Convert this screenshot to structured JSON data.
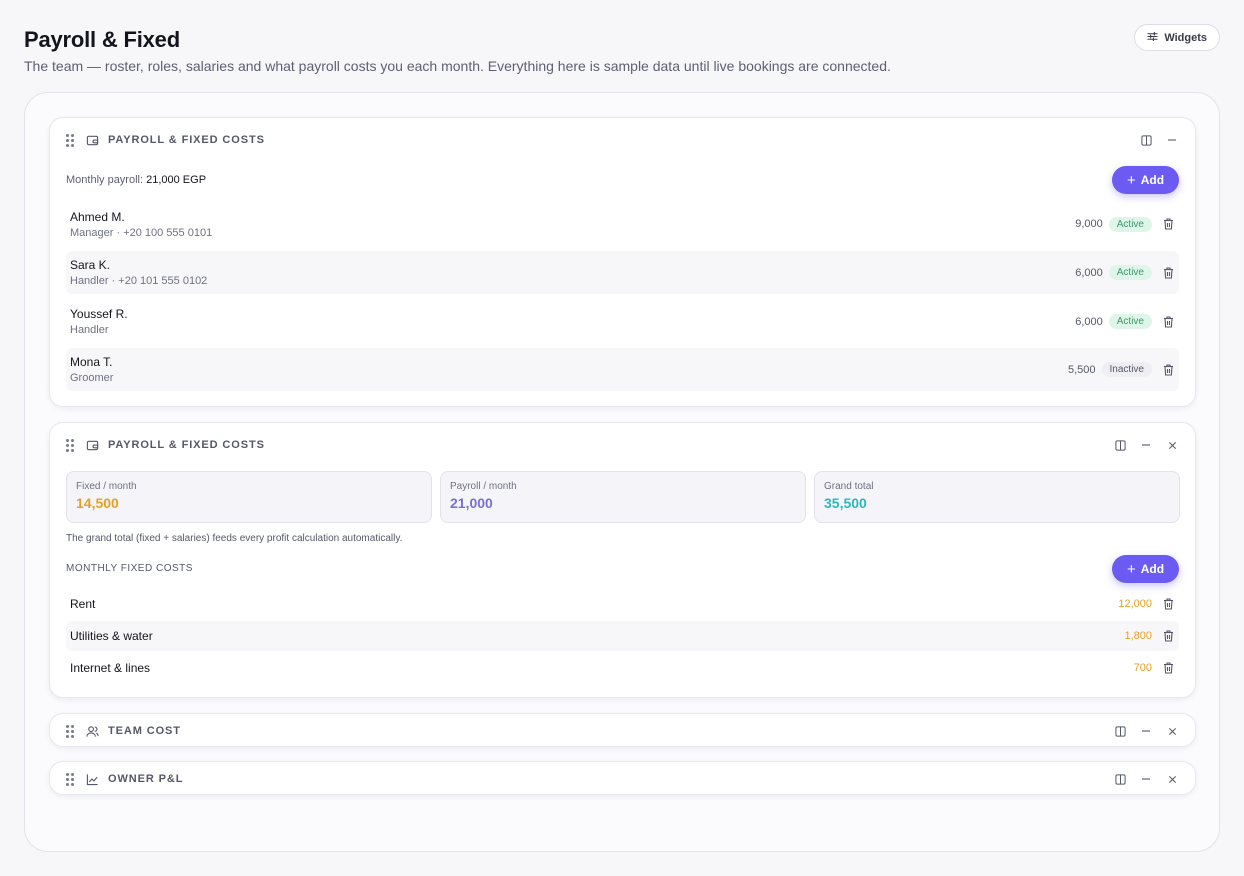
{
  "page": {
    "title": "Payroll & Fixed",
    "subtitle": "The team — roster, roles, salaries and what payroll costs you each month. Everything here is sample data until live bookings are connected.",
    "widgets_label": "Widgets"
  },
  "payroll": {
    "title": "PAYROLL & FIXED COSTS",
    "monthly_label": "Monthly payroll:",
    "monthly_value": "21,000 EGP",
    "add_label": "Add",
    "staff": [
      {
        "name": "Ahmed M.",
        "detail": "Manager · +20 100 555 0101",
        "salary": "9,000",
        "status": "Active"
      },
      {
        "name": "Sara K.",
        "detail": "Handler · +20 101 555 0102",
        "salary": "6,000",
        "status": "Active"
      },
      {
        "name": "Youssef R.",
        "detail": "Handler",
        "salary": "6,000",
        "status": "Active"
      },
      {
        "name": "Mona T.",
        "detail": "Groomer",
        "salary": "5,500",
        "status": "Inactive"
      }
    ]
  },
  "fixed": {
    "title": "PAYROLL & FIXED COSTS",
    "stats": [
      {
        "label": "Fixed / month",
        "value": "14,500",
        "color": "#e8a020"
      },
      {
        "label": "Payroll / month",
        "value": "21,000",
        "color": "#7b6fd0"
      },
      {
        "label": "Grand total",
        "value": "35,500",
        "color": "#2bb8b8"
      }
    ],
    "note": "The grand total (fixed + salaries) feeds every profit calculation automatically.",
    "section_label": "MONTHLY FIXED COSTS",
    "add_label": "Add",
    "costs": [
      {
        "name": "Rent",
        "amount": "12,000"
      },
      {
        "name": "Utilities & water",
        "amount": "1,800"
      },
      {
        "name": "Internet & lines",
        "amount": "700"
      }
    ]
  },
  "team_cost": {
    "title": "TEAM COST"
  },
  "owner_pl": {
    "title": "OWNER P&L"
  },
  "colors": {
    "accent": "#6b5bf2",
    "active_text": "#3a9a68",
    "fixed_amount": "#e8a020"
  }
}
